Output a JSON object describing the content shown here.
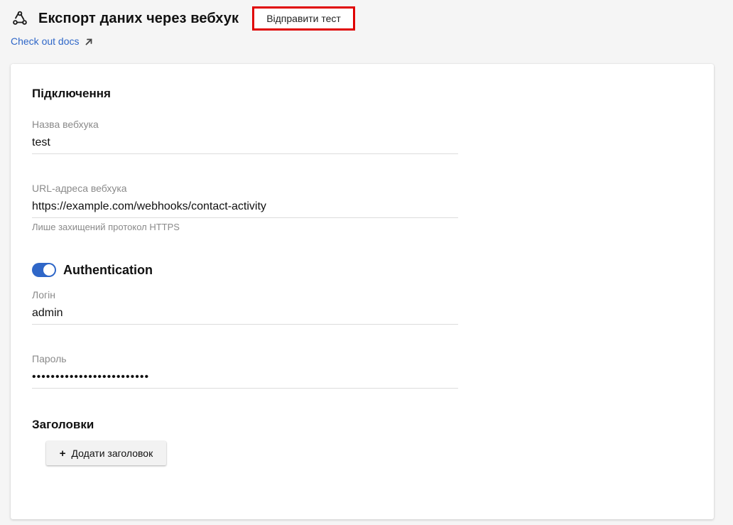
{
  "header": {
    "icon": "webhook-icon",
    "title": "Експорт даних через вебхук",
    "send_test_label": "Відправити тест",
    "docs_link_label": "Check out docs",
    "docs_link_icon": "external-arrow-icon",
    "accent_color": "#2f67c8",
    "highlight_color": "#e00000"
  },
  "connection": {
    "section_title": "Підключення",
    "webhook_name": {
      "label": "Назва вебхука",
      "value": "test"
    },
    "webhook_url": {
      "label": "URL-адреса вебхука",
      "value": "https://example.com/webhooks/contact-activity",
      "helper": "Лише захищений протокол HTTPS"
    }
  },
  "authentication": {
    "toggle_label": "Authentication",
    "enabled": true,
    "login": {
      "label": "Логін",
      "value": "admin"
    },
    "password": {
      "label": "Пароль",
      "value": "•••••••••••••••••••••••••"
    }
  },
  "headers_section": {
    "section_title": "Заголовки",
    "add_button_label": "Додати заголовок",
    "add_button_icon": "plus-icon"
  }
}
